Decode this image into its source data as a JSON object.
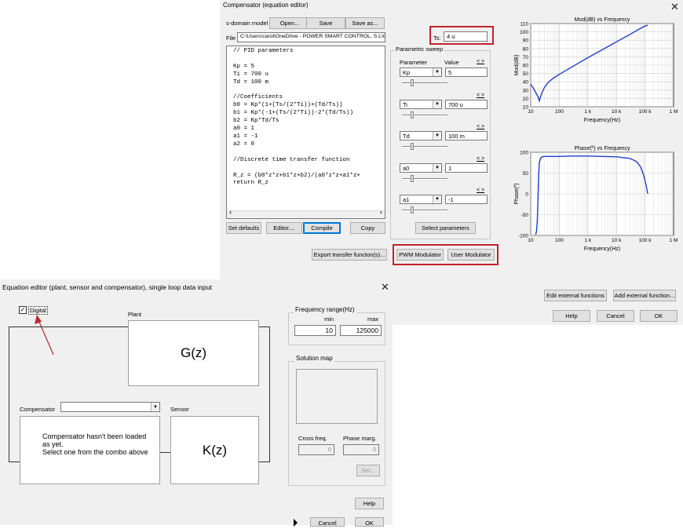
{
  "compensator_window": {
    "title": "Compensator (equation editor)",
    "sdomain_label": "s-domain model",
    "open_label": "Open...",
    "save_label": "Save",
    "saveas_label": "Save as...",
    "file_label": "File",
    "file_path": "C:\\Users\\carol\\OneDrive - POWER SMART CONTROL, S.L\\CAR",
    "ts_label": "Ts:",
    "ts_value": "4 u",
    "code_lines": [
      "// PID parameters",
      "",
      "Kp = 5",
      "Ti = 700 u",
      "Td = 100 m",
      "",
      "//Coefficients",
      "b0 = Kp*(1+(Ts/(2*Ti))+(Td/Ts))",
      "b1 = Kp*(-1+(Ts/(2*Ti))-2*(Td/Ts))",
      "b2 = Kp*Td/Ts",
      "a0 = 1",
      "a1 = -1",
      "a2 = 0",
      "",
      "//Discrete time transfer function",
      "",
      "R_z = (b0*z*z+b1*z+b2)/(a0*z*z+a1*z+",
      "return R_z"
    ],
    "set_defaults_label": "Set defaults",
    "editor_label": "Editor....",
    "compile_label": "Compile",
    "copy_label": "Copy",
    "export_label": "Export transfer functon(s)...",
    "sweep": {
      "title": "Parametric sweep",
      "param_header": "Parameter",
      "value_header": "Value",
      "link_label": "< >",
      "rows": [
        {
          "param": "Kp",
          "value": "5",
          "thumb": 0.2
        },
        {
          "param": "Ti",
          "value": "700 u",
          "thumb": 0.2
        },
        {
          "param": "Td",
          "value": "100 m",
          "thumb": 0.2
        },
        {
          "param": "a0",
          "value": "1",
          "thumb": 0.2
        },
        {
          "param": "a1",
          "value": "-1",
          "thumb": 0.2
        }
      ],
      "select_label": "Select parameters"
    },
    "pwm_label": "PWM Modulator",
    "user_mod_label": "User Modulator",
    "edit_ext_label": "Edit external functions",
    "add_ext_label": "Add external function...",
    "help_label": "Help",
    "cancel_label": "Cancel",
    "ok_label": "OK",
    "close_glyph": "✕"
  },
  "chart_data": [
    {
      "type": "line",
      "title": "Mod(dB) vs Frequency",
      "xlabel": "Frequency(Hz)",
      "ylabel": "Mod(dB)",
      "xscale": "log",
      "xlim": [
        10,
        1000000
      ],
      "ylim": [
        10,
        110
      ],
      "x_ticks": [
        "10",
        "100",
        "1 k",
        "10 k",
        "100 k",
        "1 M"
      ],
      "y_ticks": [
        "10",
        "20",
        "30",
        "40",
        "50",
        "60",
        "70",
        "80",
        "90",
        "100",
        "110"
      ],
      "grid": true,
      "color": "#1f3fd0",
      "series": [
        {
          "x": [
            10,
            12,
            15,
            18,
            20,
            22,
            25,
            30,
            40,
            60,
            100,
            200,
            500,
            1000,
            3000,
            10000,
            30000,
            60000,
            100000,
            125000
          ],
          "y": [
            37,
            33,
            27,
            22,
            17,
            22,
            27,
            33,
            39,
            44,
            49,
            55,
            63,
            69,
            78,
            88,
            97,
            103,
            107,
            108
          ]
        }
      ]
    },
    {
      "type": "line",
      "title": "Phase(º) vs Frequency",
      "xlabel": "Frequency(Hz)",
      "ylabel": "Phase(º)",
      "xscale": "log",
      "xlim": [
        10,
        1000000
      ],
      "ylim": [
        -100,
        100
      ],
      "x_ticks": [
        "10",
        "100",
        "1 k",
        "10 k",
        "100 k",
        "1 M"
      ],
      "y_ticks": [
        "100",
        "50",
        "0",
        "-50",
        "-100"
      ],
      "grid": true,
      "color": "#1f3fd0",
      "series": [
        {
          "x": [
            15,
            16,
            17,
            18,
            19,
            20,
            22,
            25,
            30,
            40,
            60,
            100,
            300,
            1000,
            3000,
            10000,
            30000,
            50000,
            70000,
            90000,
            110000,
            125000
          ],
          "y": [
            -98,
            -90,
            -65,
            -10,
            45,
            75,
            85,
            89,
            90,
            90,
            90,
            90,
            91,
            91,
            90,
            89,
            85,
            78,
            65,
            45,
            20,
            0
          ]
        }
      ]
    }
  ],
  "equation_window": {
    "title": "Equation editor (plant, sensor and compensator), single loop data input",
    "close_glyph": "✕",
    "digital_label": "Digital",
    "digital_checked": true,
    "plant_label": "Plant",
    "plant_expr": "G(z)",
    "compensator_label": "Compensator",
    "compensator_value": "",
    "sensor_label": "Sensor",
    "sensor_expr": "K(z)",
    "comp_message": "Compensator hasn't been loaded as yet.\nSelect one from the combo above",
    "freq_title": "Frequency range(Hz)",
    "min_label": "min",
    "max_label": "max",
    "min_value": "10",
    "max_value": "125000",
    "solution_title": "Solution map",
    "cross_label": "Cross freq.",
    "phase_label": "Phase marg.",
    "cross_value": "0",
    "phase_value": "0",
    "set_label": "Set...",
    "help_label": "Help",
    "cancel_label": "Cancel",
    "ok_label": "OK"
  }
}
